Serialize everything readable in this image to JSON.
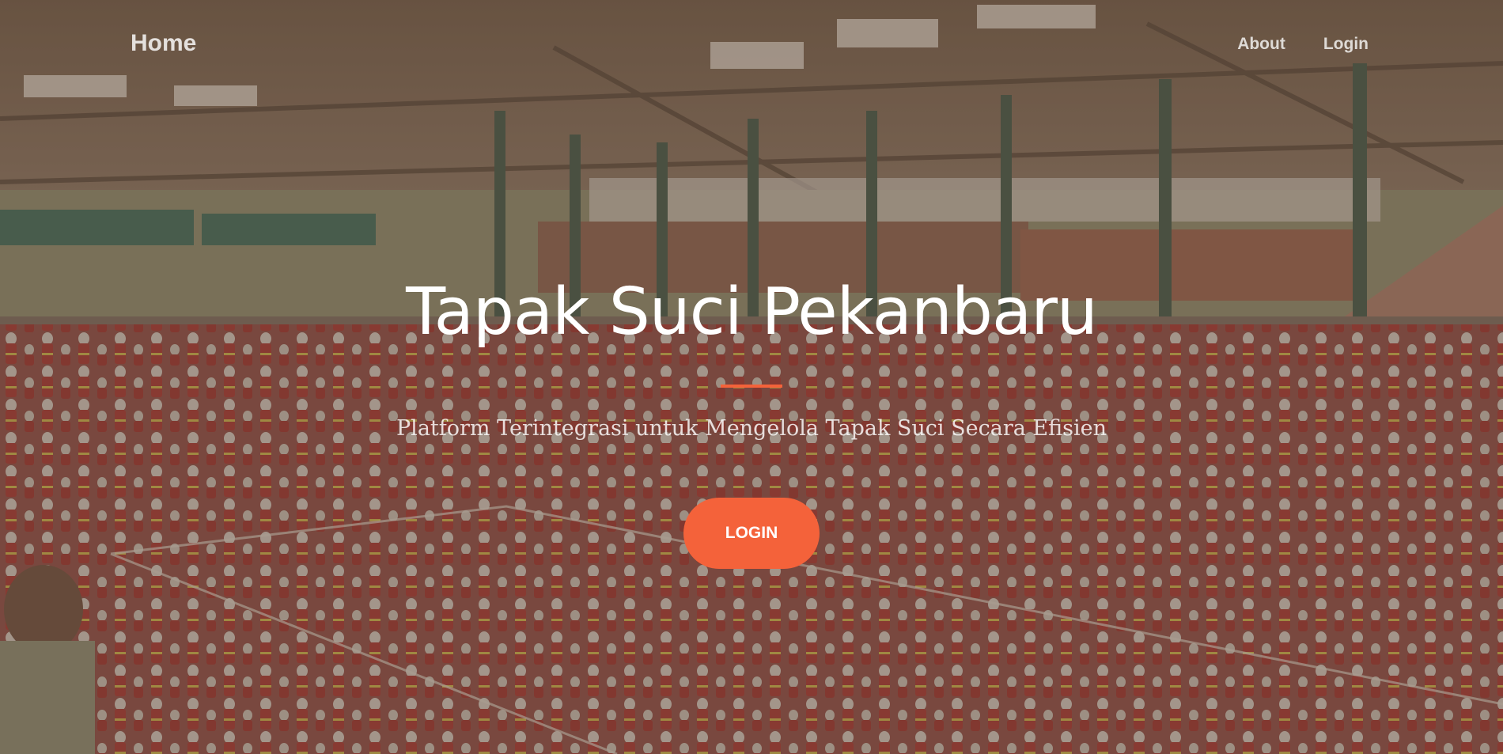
{
  "navbar": {
    "brand": "Home",
    "links": [
      "About",
      "Login"
    ]
  },
  "hero": {
    "title": "Tapak Suci Pekanbaru",
    "subtitle": "Platform Terintegrasi untuk Mengelola Tapak Suci Secara Efisien",
    "cta_label": "LOGIN",
    "background_image": "hall-photo-martial-artists-in-red-uniforms"
  },
  "colors": {
    "accent": "#f4623a",
    "overlay": "#5c4637",
    "text": "#ffffff"
  }
}
